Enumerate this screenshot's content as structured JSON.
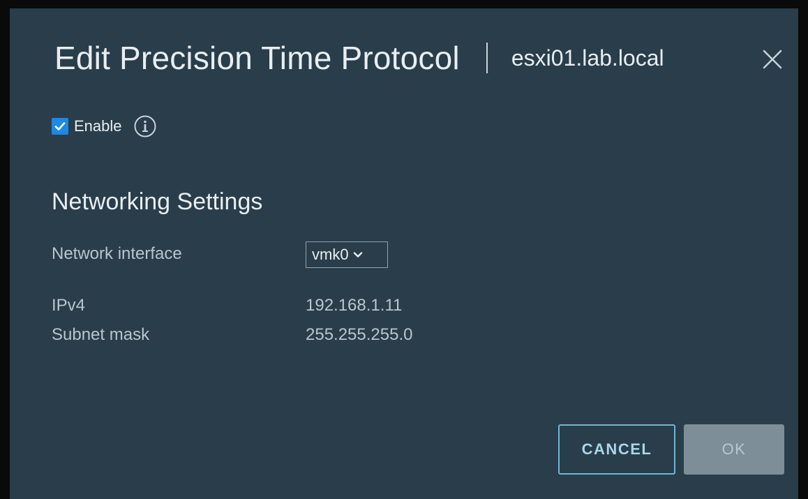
{
  "dialog": {
    "title": "Edit Precision Time Protocol",
    "host": "esxi01.lab.local"
  },
  "enable": {
    "label": "Enable",
    "checked": true
  },
  "networking": {
    "section_title": "Networking Settings",
    "interface_label": "Network interface",
    "interface_value": "vmk0",
    "ipv4_label": "IPv4",
    "ipv4_value": "192.168.1.11",
    "subnet_label": "Subnet mask",
    "subnet_value": "255.255.255.0"
  },
  "buttons": {
    "cancel": "CANCEL",
    "ok": "OK"
  },
  "icons": {
    "close": "close-icon",
    "info": "info-icon",
    "check": "check-icon",
    "chevron": "chevron-down-icon"
  },
  "colors": {
    "dialog_bg": "#293d4a",
    "checkbox": "#1e88e5",
    "cancel_border": "#72b6d6",
    "ok_disabled": "#7d8e98"
  }
}
